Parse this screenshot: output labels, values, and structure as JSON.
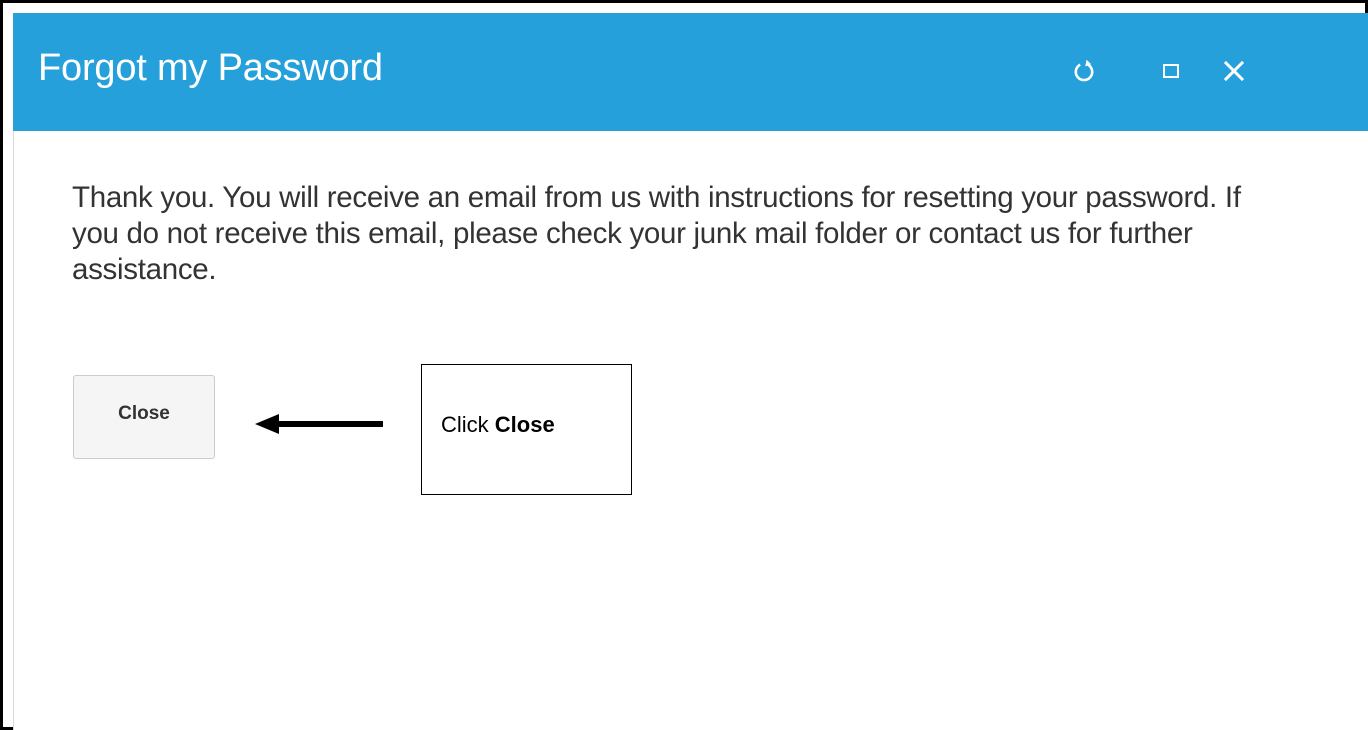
{
  "dialog": {
    "title": "Forgot my Password",
    "accent_color": "#26a0da",
    "controls": [
      {
        "name": "refresh",
        "icon": "refresh-icon"
      },
      {
        "name": "maximize",
        "icon": "maximize-icon"
      },
      {
        "name": "close",
        "icon": "close-icon"
      }
    ],
    "message": "Thank you. You will receive an email from us with instructions for resetting your password. If you do not receive this email, please check your junk mail folder or contact us for further assistance.",
    "close_button_label": "Close"
  },
  "annotation": {
    "arrow_icon": "left-arrow-icon",
    "text_prefix": "Click",
    "text_bold": "Close"
  }
}
